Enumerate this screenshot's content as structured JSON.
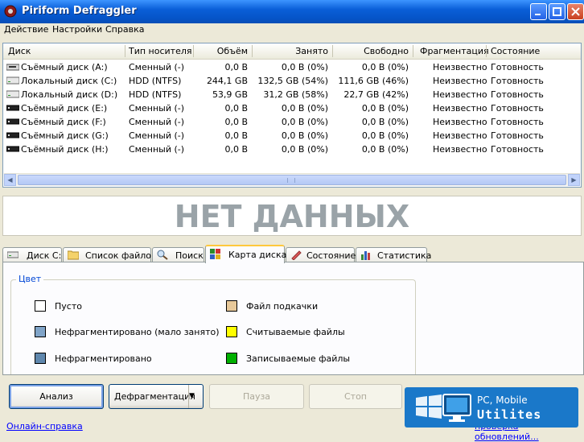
{
  "window": {
    "title": "Piriform Defraggler",
    "icon": "defraggler-app-icon"
  },
  "menu": [
    "Действие",
    "Настройки",
    "Справка"
  ],
  "columns": [
    "Диск",
    "Тип носителя",
    "Объём",
    "Занято",
    "Свободно",
    "Фрагментация",
    "Состояние"
  ],
  "drives": [
    {
      "name": "Съёмный диск (A:)",
      "type": "Сменный (-)",
      "size": "0,0 B",
      "used": "0,0 B (0%)",
      "free": "0,0 B (0%)",
      "frag": "Неизвестно",
      "state": "Готовность",
      "icon": "floppy-drive-icon"
    },
    {
      "name": "Локальный диск (C:)",
      "type": "HDD (NTFS)",
      "size": "244,1 GB",
      "used": "132,5 GB (54%)",
      "free": "111,6 GB (46%)",
      "frag": "Неизвестно",
      "state": "Готовность",
      "icon": "hard-drive-icon"
    },
    {
      "name": "Локальный диск (D:)",
      "type": "HDD (NTFS)",
      "size": "53,9 GB",
      "used": "31,2 GB (58%)",
      "free": "22,7 GB (42%)",
      "frag": "Неизвестно",
      "state": "Готовность",
      "icon": "hard-drive-icon"
    },
    {
      "name": "Съёмный диск (E:)",
      "type": "Сменный (-)",
      "size": "0,0 B",
      "used": "0,0 B (0%)",
      "free": "0,0 B (0%)",
      "frag": "Неизвестно",
      "state": "Готовность",
      "icon": "removable-drive-icon"
    },
    {
      "name": "Съёмный диск (F:)",
      "type": "Сменный (-)",
      "size": "0,0 B",
      "used": "0,0 B (0%)",
      "free": "0,0 B (0%)",
      "frag": "Неизвестно",
      "state": "Готовность",
      "icon": "removable-drive-icon"
    },
    {
      "name": "Съёмный диск (G:)",
      "type": "Сменный (-)",
      "size": "0,0 B",
      "used": "0,0 B (0%)",
      "free": "0,0 B (0%)",
      "frag": "Неизвестно",
      "state": "Готовность",
      "icon": "removable-drive-icon"
    },
    {
      "name": "Съёмный диск (H:)",
      "type": "Сменный (-)",
      "size": "0,0 B",
      "used": "0,0 B (0%)",
      "free": "0,0 B (0%)",
      "frag": "Неизвестно",
      "state": "Готовность",
      "icon": "removable-drive-icon"
    }
  ],
  "no_data_text": "НЕТ ДАННЫХ",
  "tabs": [
    {
      "label": "Диск C:",
      "icon": "drive-icon",
      "active": false
    },
    {
      "label": "Список файлов",
      "icon": "folder-icon",
      "active": false
    },
    {
      "label": "Поиск",
      "icon": "search-icon",
      "active": false
    },
    {
      "label": "Карта диска",
      "icon": "disk-map-icon",
      "active": true
    },
    {
      "label": "Состояние",
      "icon": "state-icon",
      "active": false
    },
    {
      "label": "Статистика",
      "icon": "statistics-icon",
      "active": false
    }
  ],
  "legend": {
    "title": "Цвет",
    "items": [
      {
        "label": "Пусто",
        "color": "#ffffff"
      },
      {
        "label": "Нефрагментировано (мало занято)",
        "color": "#80a4c8"
      },
      {
        "label": "Нефрагментировано",
        "color": "#5f87ad"
      },
      {
        "label": "Файл подкачки",
        "color": "#e8c99a"
      },
      {
        "label": "Считываемые файлы",
        "color": "#ffff00"
      },
      {
        "label": "Записываемые файлы",
        "color": "#00b000"
      }
    ]
  },
  "buttons": {
    "analyze": "Анализ",
    "defrag": "Дефрагментация",
    "pause": "Пауза",
    "stop": "Стоп"
  },
  "links": {
    "online_help": "Онлайн-справка",
    "check_updates": "проверка обновлений..."
  },
  "watermark": {
    "line1": "PC, Mobile",
    "line2": "Utilites"
  }
}
